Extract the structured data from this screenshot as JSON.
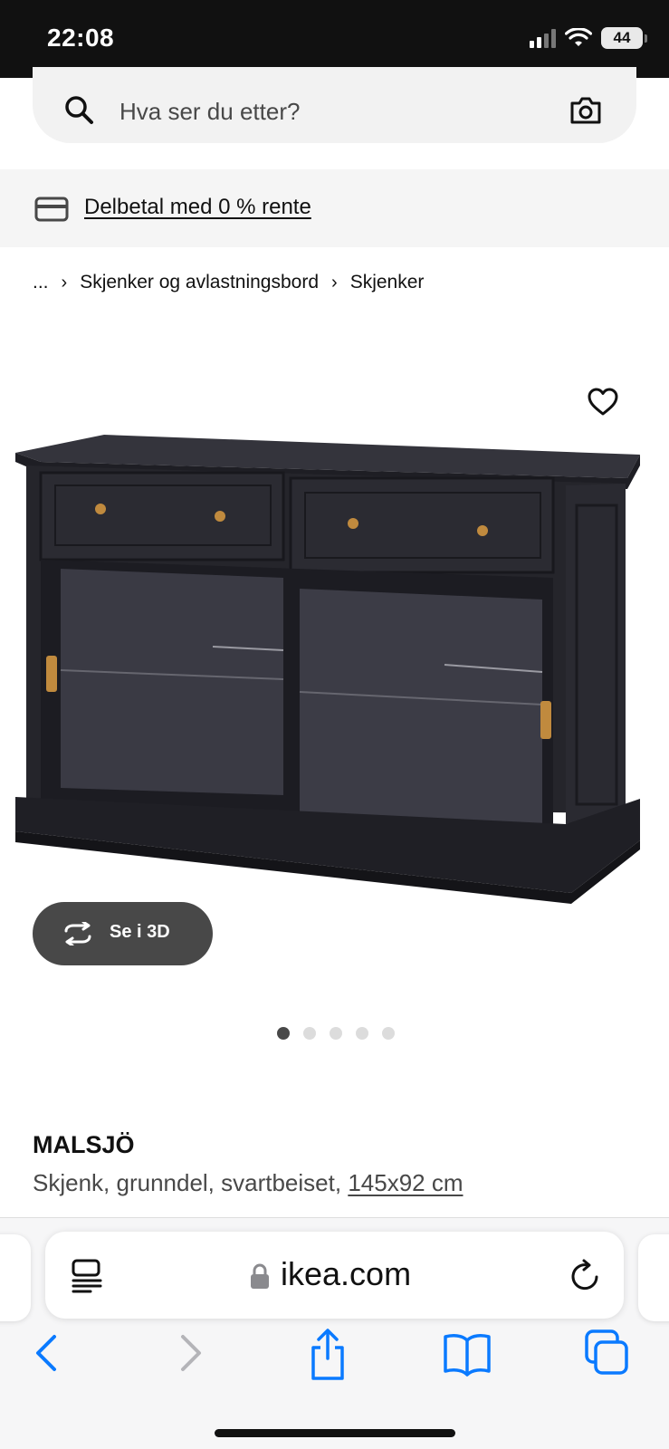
{
  "status_bar": {
    "time": "22:08",
    "battery": "44",
    "icons": [
      "cellular-signal-icon",
      "wifi-icon",
      "battery-icon"
    ]
  },
  "search": {
    "placeholder": "Hva ser du etter?",
    "icons": [
      "search-icon",
      "camera-icon"
    ]
  },
  "promo": {
    "link_text": "Delbetal med 0 % rente",
    "icon": "credit-card-icon"
  },
  "breadcrumb": {
    "items": [
      "...",
      "Skjenker og avlastningsbord",
      "Skjenker"
    ],
    "separator": "›"
  },
  "gallery": {
    "favorite_icon": "heart-icon",
    "view3d_label": "Se i 3D",
    "view3d_icon": "rotate-3d-icon",
    "image_count": 5,
    "active_index": 0
  },
  "product": {
    "name": "MALSJÖ",
    "description": "Skjenk, grunndel, svartbeiset,",
    "size": "145x92 cm"
  },
  "browser": {
    "url": "ikea.com",
    "icons": [
      "reader-mode-icon",
      "lock-icon",
      "reload-icon"
    ],
    "toolbar_icons": [
      "back-icon",
      "forward-icon",
      "share-icon",
      "bookmarks-icon",
      "tabs-icon"
    ]
  },
  "colors": {
    "status_bar_bg": "#111111",
    "search_bg": "#f2f2f2",
    "button_dark": "#484848",
    "safari_blue": "#0a7aff",
    "text_primary": "#111111",
    "text_secondary": "#484848"
  }
}
